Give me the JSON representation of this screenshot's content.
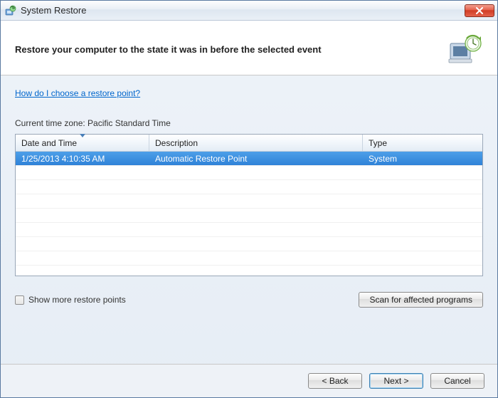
{
  "window": {
    "title": "System Restore"
  },
  "header": {
    "heading": "Restore your computer to the state it was in before the selected event"
  },
  "content": {
    "help_link": "How do I choose a restore point?",
    "timezone_label": "Current time zone: Pacific Standard Time",
    "columns": {
      "date": "Date and Time",
      "desc": "Description",
      "type": "Type"
    },
    "rows": [
      {
        "date": "1/25/2013 4:10:35 AM",
        "desc": "Automatic Restore Point",
        "type": "System",
        "selected": true
      }
    ],
    "show_more_label": "Show more restore points",
    "scan_button": "Scan for affected programs"
  },
  "footer": {
    "back": "< Back",
    "next": "Next >",
    "cancel": "Cancel"
  }
}
